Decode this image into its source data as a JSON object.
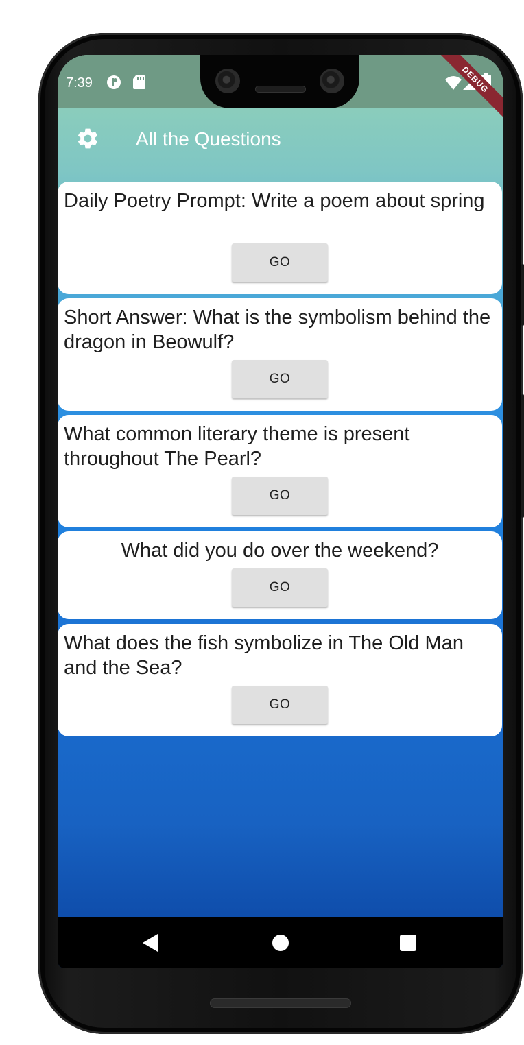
{
  "status": {
    "time": "7:39",
    "left_icons": [
      "app-notification-icon",
      "sd-card-icon"
    ],
    "right_icons": [
      "wifi-icon",
      "signal-icon",
      "battery-icon"
    ]
  },
  "debug_banner": "DEBUG",
  "appbar": {
    "title": "All the Questions",
    "settings_icon": "gear-icon"
  },
  "questions": [
    {
      "text": "Daily Poetry Prompt: Write a poem about spring",
      "button": "GO"
    },
    {
      "text": "Short Answer: What is the symbolism behind the dragon in Beowulf?",
      "button": "GO"
    },
    {
      "text": "What common literary theme is present throughout The Pearl?",
      "button": "GO"
    },
    {
      "text": "What did you do over the weekend?",
      "button": "GO"
    },
    {
      "text": "What does the fish symbolize in The Old Man and the Sea?",
      "button": "GO"
    }
  ],
  "navbar": {
    "back_icon": "back-triangle-icon",
    "home_icon": "home-circle-icon",
    "recents_icon": "recents-square-icon"
  },
  "colors": {
    "statusbar": "#6f9a85",
    "gradient_top": "#94d2b5",
    "gradient_bottom": "#0a47a5",
    "card": "#ffffff",
    "button": "#e0e0e0",
    "debug_ribbon": "#8a2731"
  }
}
